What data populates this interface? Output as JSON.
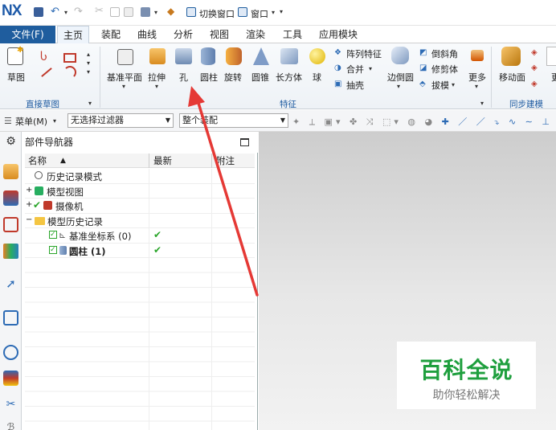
{
  "app": {
    "logo": "NX"
  },
  "quick_access": {
    "switch_window": "切换窗口",
    "window": "窗口",
    "more_arrow": "▾"
  },
  "menubar": {
    "tabs": [
      "文件(F)",
      "主页",
      "装配",
      "曲线",
      "分析",
      "视图",
      "渲染",
      "工具",
      "应用模块"
    ],
    "active": "主页"
  },
  "ribbon": {
    "sketch": "草图",
    "direct_sketch_group": "直接草图",
    "features": [
      "基准平面",
      "拉伸",
      "孔",
      "圆柱",
      "旋转",
      "圆锥",
      "长方体",
      "球"
    ],
    "features_small": [
      "阵列特征",
      "合并",
      "抽壳"
    ],
    "edge_blend": "边倒圆",
    "small2": [
      "倒斜角",
      "修剪体",
      "拔模"
    ],
    "more": "更多",
    "feature_group": "特征",
    "move_face": "移动面",
    "sync_group": "同步建模",
    "cut_char": "更"
  },
  "filterbar": {
    "menu": "菜单(M)",
    "filter": "无选择过滤器",
    "assembly": "整个装配"
  },
  "navigator": {
    "title": "部件导航器",
    "columns": {
      "name": "名称",
      "sort": "▲",
      "latest": "最新",
      "note": "附注"
    },
    "rows": [
      {
        "label": "历史记录模式",
        "expander": "",
        "latest": ""
      },
      {
        "label": "模型视图",
        "expander": "+",
        "latest": ""
      },
      {
        "label": "摄像机",
        "expander": "+",
        "latest": ""
      },
      {
        "label": "模型历史记录",
        "expander": "−",
        "latest": ""
      },
      {
        "label": "基准坐标系 (0)",
        "expander": "",
        "latest": "✔"
      },
      {
        "label": "圆柱 (1)",
        "expander": "",
        "latest": "✔"
      }
    ]
  },
  "watermark": {
    "title": "百科全说",
    "subtitle": "助你轻松解决"
  },
  "colors": {
    "accent": "#1f5d9e",
    "arrow": "#e53935",
    "check": "#2aa52a",
    "watermark_green": "#1f9f3e"
  }
}
